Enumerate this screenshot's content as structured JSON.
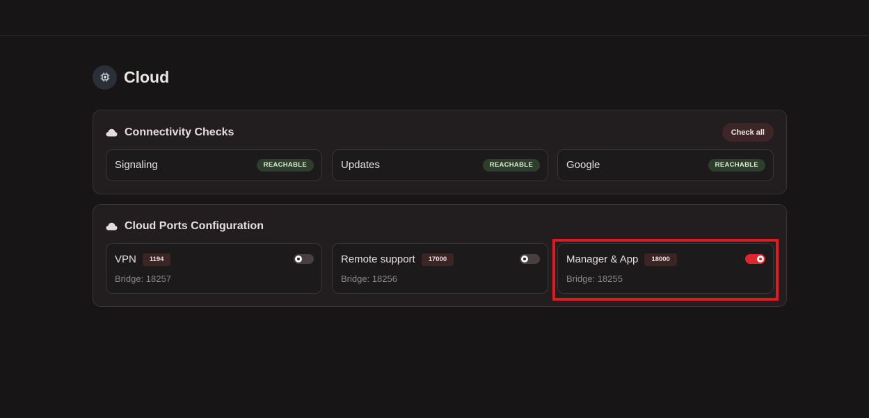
{
  "page": {
    "title": "Cloud",
    "icon": "chip-icon"
  },
  "connectivity": {
    "title": "Connectivity Checks",
    "icon": "cloud-icon",
    "check_all_label": "Check all",
    "checks": [
      {
        "label": "Signaling",
        "status": "REACHABLE"
      },
      {
        "label": "Updates",
        "status": "REACHABLE"
      },
      {
        "label": "Google",
        "status": "REACHABLE"
      }
    ]
  },
  "ports": {
    "title": "Cloud Ports Configuration",
    "icon": "cloud-icon",
    "items": [
      {
        "name": "VPN",
        "port": "1194",
        "bridge": "Bridge: 18257",
        "enabled": false
      },
      {
        "name": "Remote support",
        "port": "17000",
        "bridge": "Bridge: 18256",
        "enabled": false
      },
      {
        "name": "Manager & App",
        "port": "18000",
        "bridge": "Bridge: 18255",
        "enabled": true
      }
    ]
  },
  "colors": {
    "accent": "#e0262c",
    "highlight": "#e3191f",
    "reachable_bg": "#2e3e2c"
  }
}
